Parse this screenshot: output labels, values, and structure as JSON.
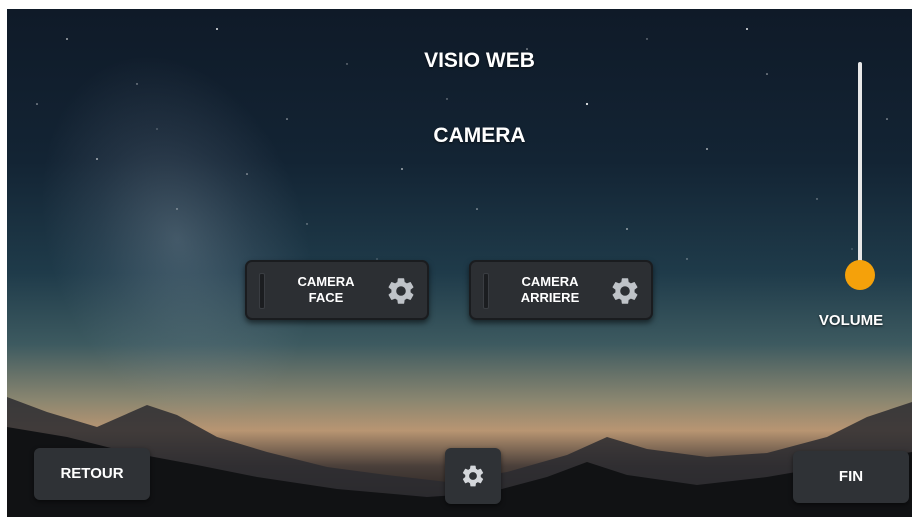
{
  "header": {
    "app_title": "VISIO WEB",
    "section_title": "CAMERA"
  },
  "camera_buttons": [
    {
      "label": "CAMERA\nFACE",
      "icon": "gear-icon"
    },
    {
      "label": "CAMERA\nARRIERE",
      "icon": "gear-icon"
    }
  ],
  "volume": {
    "label": "VOLUME",
    "level": 0.0
  },
  "footer": {
    "back_label": "RETOUR",
    "settings_icon": "gear-icon",
    "end_label": "FIN"
  },
  "colors": {
    "accent": "#f5a10a",
    "button_bg": "#2c2f33",
    "text": "#ffffff"
  }
}
